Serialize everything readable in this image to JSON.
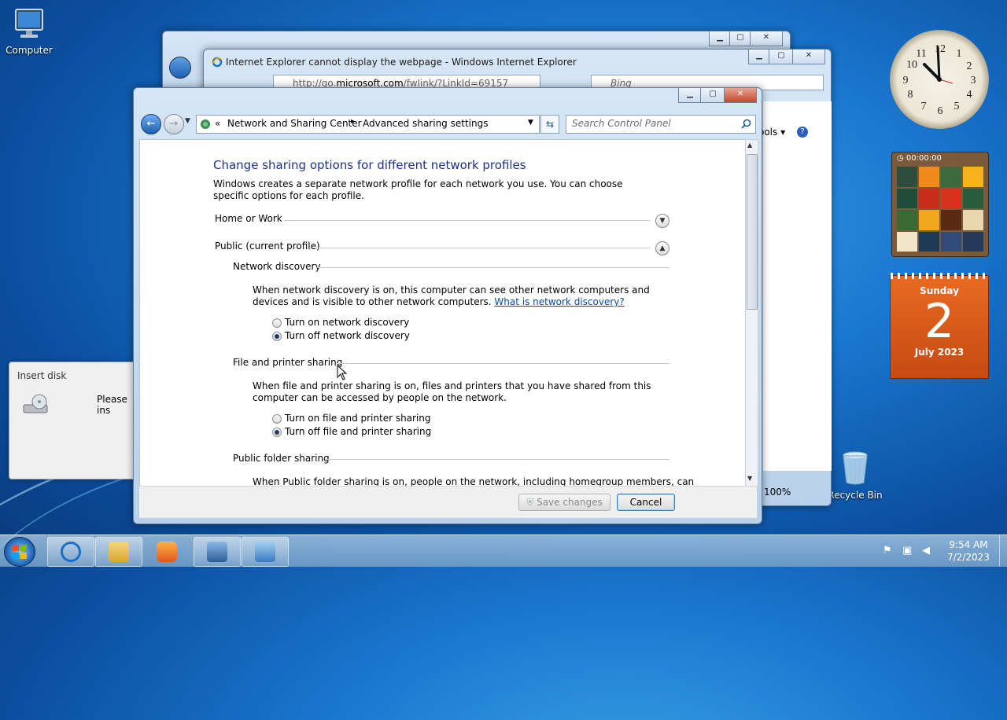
{
  "desktop": {
    "icons": [
      {
        "label": "Computer"
      },
      {
        "label": "Recycle Bin"
      }
    ]
  },
  "ie_window": {
    "title": "Internet Explorer cannot display the webpage - Windows Internet Explorer",
    "url_prefix": "http://go.",
    "url_domain": "microsoft.com",
    "url_path": "/fwlink/?LinkId=69157",
    "search_placeholder": "Bing",
    "tools_label": "ools ▾",
    "zoom_label": "100%"
  },
  "control_panel": {
    "breadcrumb_prefix": "«",
    "breadcrumb": [
      "Network and Sharing Center",
      "Advanced sharing settings"
    ],
    "search_placeholder": "Search Control Panel",
    "heading": "Change sharing options for different network profiles",
    "intro": "Windows creates a separate network profile for each network you use. You can choose specific options for each profile.",
    "profiles": [
      {
        "label": "Home or Work",
        "expanded": false
      },
      {
        "label": "Public (current profile)",
        "expanded": true
      }
    ],
    "network_discovery": {
      "title": "Network discovery",
      "description": "When network discovery is on, this computer can see other network computers and devices and is visible to other network computers.",
      "link": "What is network discovery?",
      "options": [
        "Turn on network discovery",
        "Turn off network discovery"
      ],
      "selected": 1
    },
    "file_printer_sharing": {
      "title": "File and printer sharing",
      "description": "When file and printer sharing is on, files and printers that you have shared from this computer can be accessed by people on the network.",
      "options": [
        "Turn on file and printer sharing",
        "Turn off file and printer sharing"
      ],
      "selected": 1
    },
    "public_folder_sharing": {
      "title": "Public folder sharing",
      "description": "When Public folder sharing is on, people on the network, including homegroup members, can"
    },
    "buttons": {
      "save": "Save changes",
      "cancel": "Cancel"
    }
  },
  "insert_disk": {
    "title": "Insert disk",
    "message": "Please ins"
  },
  "gadgets": {
    "clock": {
      "time": "9:54"
    },
    "puzzle": {
      "timer": "00:00:00"
    },
    "calendar": {
      "weekday": "Sunday",
      "day": "2",
      "month_year": "July 2023"
    }
  },
  "taskbar": {
    "time": "9:54 AM",
    "date": "7/2/2023"
  },
  "colors": {
    "heading": "#1e3287",
    "link": "#0a4aa8",
    "calendar": "#e0601c"
  }
}
